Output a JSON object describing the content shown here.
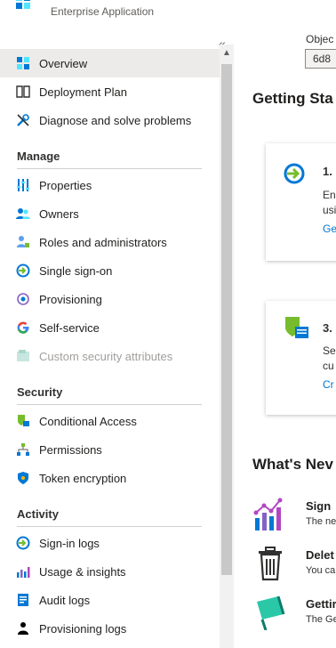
{
  "header": {
    "subtitle": "Enterprise Application"
  },
  "sidebar": {
    "collapse_icon": "«",
    "top_items": [
      {
        "label": "Overview",
        "icon": "grid-icon",
        "selected": true
      },
      {
        "label": "Deployment Plan",
        "icon": "book-icon"
      },
      {
        "label": "Diagnose and solve problems",
        "icon": "wrench-icon"
      }
    ],
    "sections": [
      {
        "title": "Manage",
        "items": [
          {
            "label": "Properties",
            "icon": "sliders-icon"
          },
          {
            "label": "Owners",
            "icon": "users-icon"
          },
          {
            "label": "Roles and administrators",
            "icon": "roles-icon"
          },
          {
            "label": "Single sign-on",
            "icon": "sso-icon"
          },
          {
            "label": "Provisioning",
            "icon": "provisioning-icon"
          },
          {
            "label": "Self-service",
            "icon": "google-g-icon"
          },
          {
            "label": "Custom security attributes",
            "icon": "attributes-icon",
            "disabled": true
          }
        ]
      },
      {
        "title": "Security",
        "items": [
          {
            "label": "Conditional Access",
            "icon": "conditional-access-icon"
          },
          {
            "label": "Permissions",
            "icon": "permissions-icon"
          },
          {
            "label": "Token encryption",
            "icon": "shield-icon"
          }
        ]
      },
      {
        "title": "Activity",
        "items": [
          {
            "label": "Sign-in logs",
            "icon": "signin-icon"
          },
          {
            "label": "Usage & insights",
            "icon": "chart-icon"
          },
          {
            "label": "Audit logs",
            "icon": "audit-icon"
          },
          {
            "label": "Provisioning logs",
            "icon": "person-icon"
          }
        ]
      }
    ]
  },
  "main": {
    "object_label": "Objec",
    "object_value": "6d8",
    "getting_started_title": "Getting Sta",
    "cards": [
      {
        "num": "1.",
        "desc_line1": "Ena",
        "desc_line2": "usi",
        "link": "Ge"
      },
      {
        "num": "3.",
        "desc_line1": "Se",
        "desc_line2": "cu",
        "link": "Cr"
      }
    ],
    "whats_new_title": "What's Nev",
    "news": [
      {
        "title": "Sign",
        "desc": "The ne"
      },
      {
        "title": "Delet",
        "desc": "You ca"
      },
      {
        "title": "Gettir",
        "desc": "The Ge"
      }
    ]
  },
  "colors": {
    "accent": "#0078d4",
    "selected_bg": "#edebe9"
  }
}
